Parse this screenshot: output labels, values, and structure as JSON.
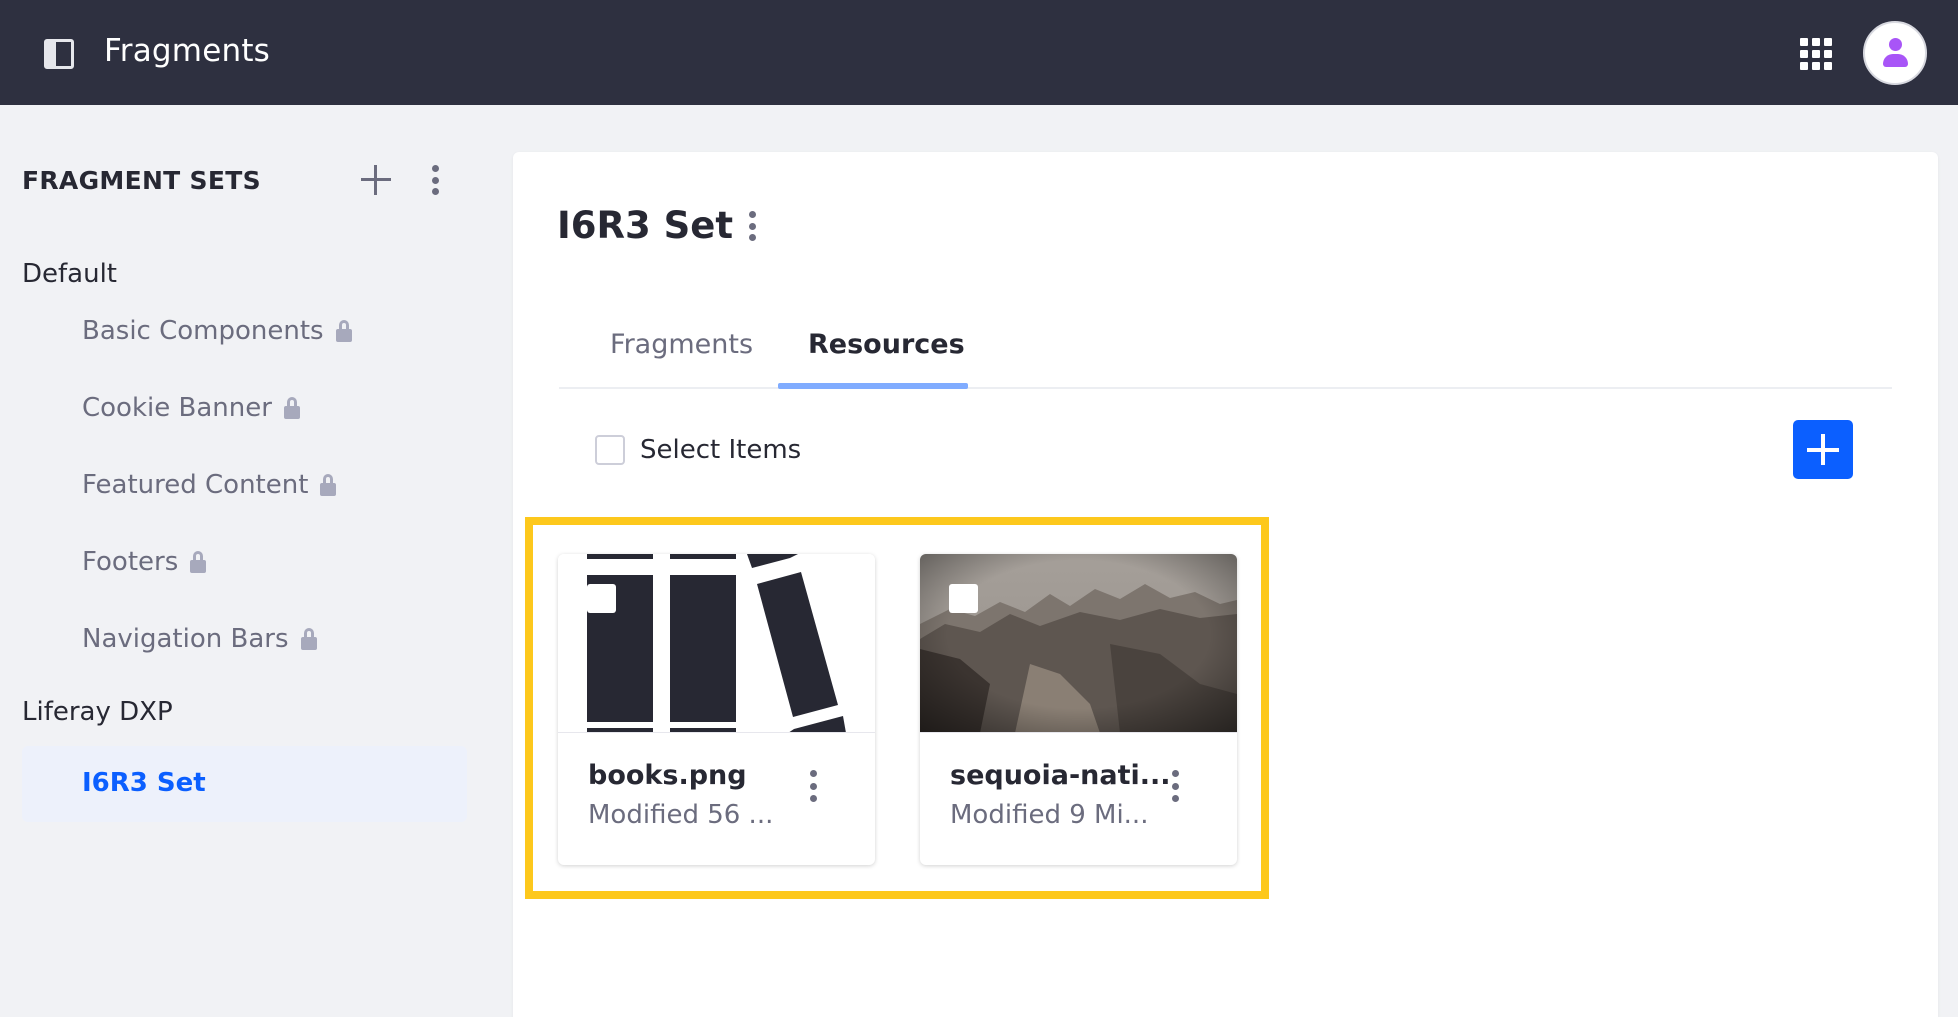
{
  "app": {
    "title": "Fragments"
  },
  "colors": {
    "header_bg": "#2e3040",
    "accent": "#0b5fff",
    "highlight": "#fdc81c",
    "avatar": "#a855f7"
  },
  "header": {
    "toggle_icon": "product-menu-icon",
    "apps_icon": "apps-grid-icon",
    "avatar_icon": "user-avatar-icon"
  },
  "sidebar": {
    "title": "FRAGMENT SETS",
    "groups": [
      {
        "label": "Default",
        "items": [
          {
            "label": "Basic Components",
            "locked": true
          },
          {
            "label": "Cookie Banner",
            "locked": true
          },
          {
            "label": "Featured Content",
            "locked": true
          },
          {
            "label": "Footers",
            "locked": true
          },
          {
            "label": "Navigation Bars",
            "locked": true
          }
        ]
      },
      {
        "label": "Liferay DXP",
        "items": [
          {
            "label": "I6R3 Set",
            "active": true
          }
        ]
      }
    ]
  },
  "main": {
    "title": "I6R3 Set",
    "tabs": [
      {
        "label": "Fragments",
        "active": false
      },
      {
        "label": "Resources",
        "active": true
      }
    ],
    "select_label": "Select Items",
    "cards": [
      {
        "name": "books.png",
        "meta": "Modified 56 ..."
      },
      {
        "name": "sequoia-nati...",
        "meta": "Modified 9 Mi..."
      }
    ]
  }
}
